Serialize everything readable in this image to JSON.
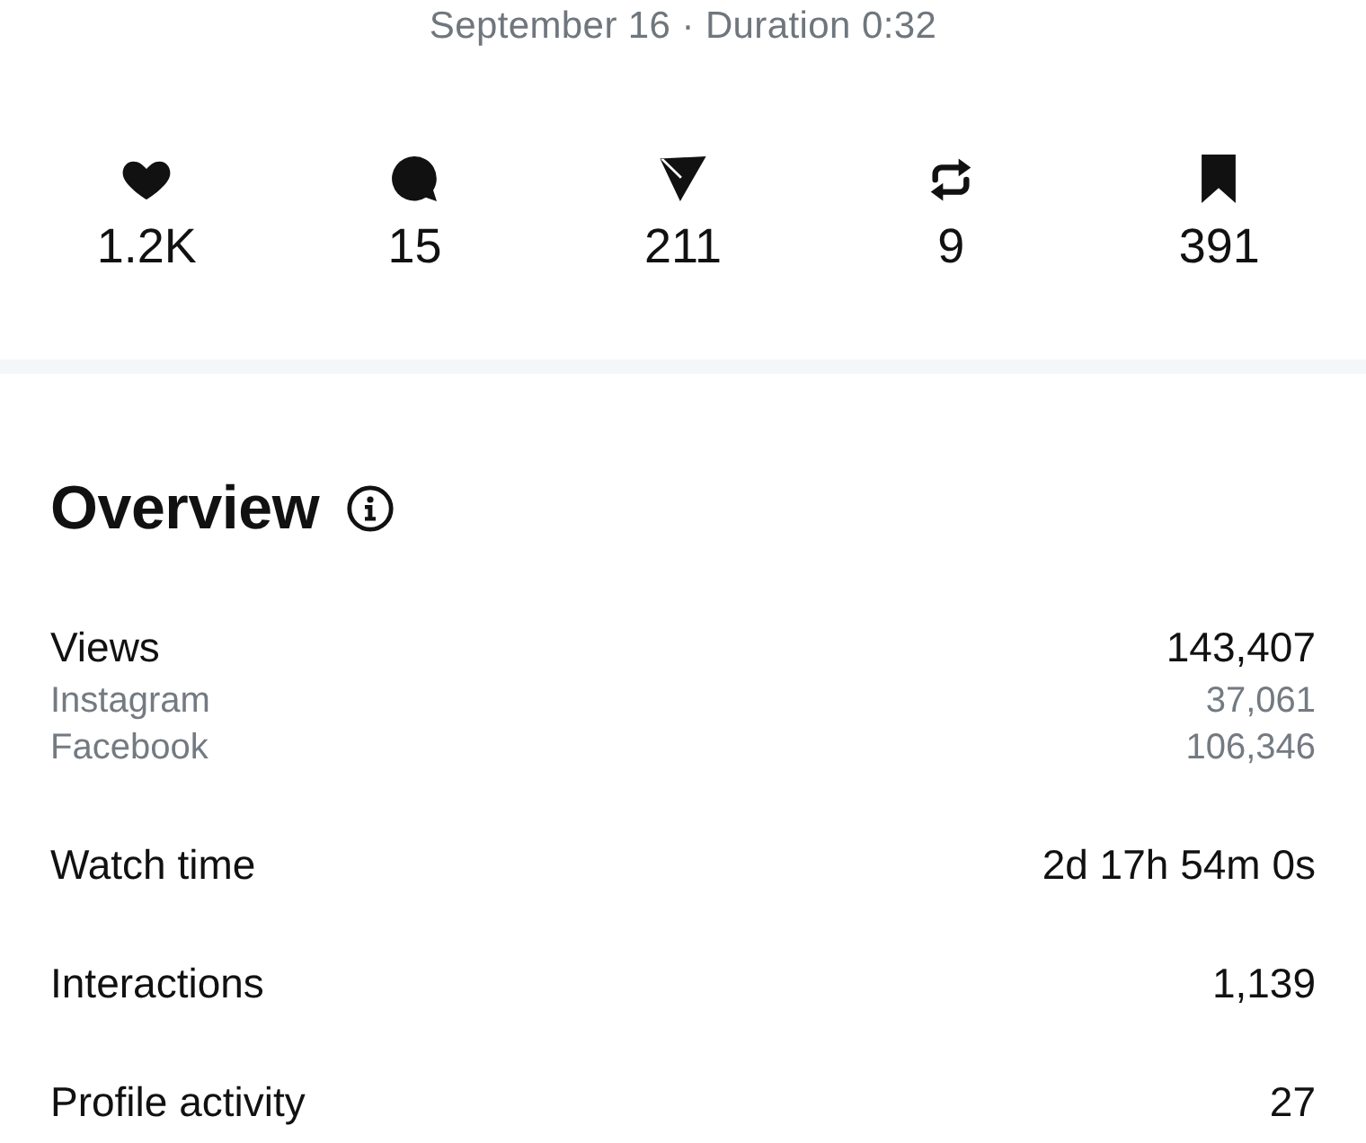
{
  "subtitle": "September 16 · Duration 0:32",
  "stats": [
    {
      "kind": "heart",
      "value": "1.2K"
    },
    {
      "kind": "comment",
      "value": "15"
    },
    {
      "kind": "send",
      "value": "211"
    },
    {
      "kind": "repost",
      "value": "9"
    },
    {
      "kind": "bookmark",
      "value": "391"
    }
  ],
  "overview": {
    "title": "Overview",
    "metrics": [
      {
        "label": "Views",
        "value": "143,407",
        "breakdown": [
          {
            "label": "Instagram",
            "value": "37,061"
          },
          {
            "label": "Facebook",
            "value": "106,346"
          }
        ]
      },
      {
        "label": "Watch time",
        "value": "2d 17h 54m 0s"
      },
      {
        "label": "Interactions",
        "value": "1,139"
      },
      {
        "label": "Profile activity",
        "value": "27"
      }
    ]
  }
}
